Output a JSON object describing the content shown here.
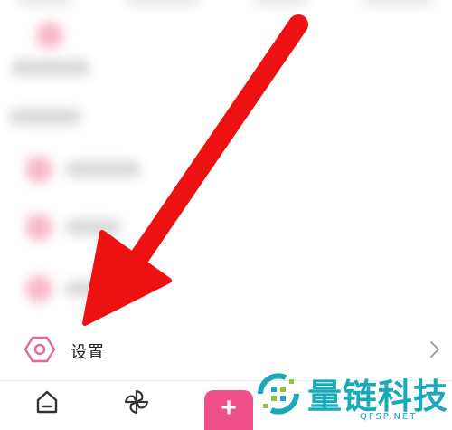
{
  "settings": {
    "label": "设置"
  },
  "tabbar": {
    "items": [
      {
        "icon": "home-icon"
      },
      {
        "icon": "pinwheel-icon"
      },
      {
        "icon": "plus-icon",
        "label": "+"
      }
    ]
  },
  "watermark": {
    "name": "量链科技",
    "site": "QFSP.NET"
  },
  "colors": {
    "accent": "#f0508a",
    "arrow": "#ee1111",
    "watermark": "#19a9b7",
    "settings_icon": "#e8669a"
  }
}
